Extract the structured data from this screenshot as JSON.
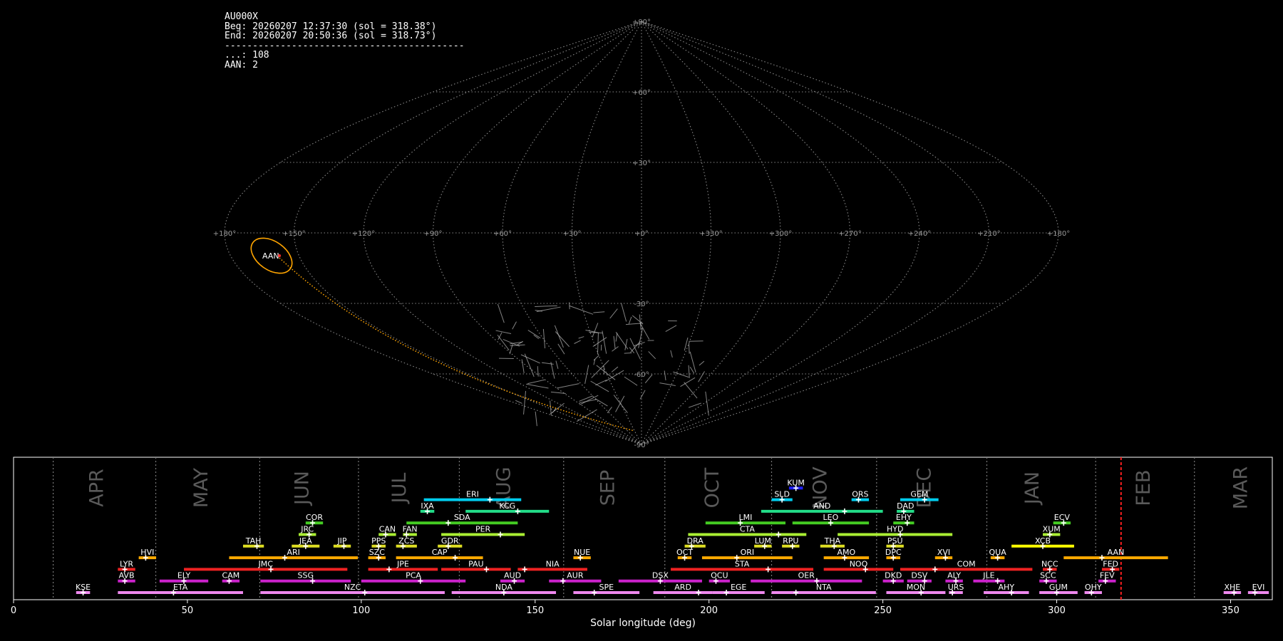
{
  "info": {
    "station": "AU000X",
    "beg": "Beg: 20260207 12:37:30 (sol = 318.38°)",
    "end": "End: 20260207 20:50:36 (sol = 318.73°)",
    "separator": "-------------------------------------------",
    "sporadic": "...: 108",
    "aan": "AAN: 2"
  },
  "sky_map": {
    "projection": "sinusoidal",
    "lon_labels": [
      "+180°",
      "+150°",
      "+120°",
      "+90°",
      "+60°",
      "+30°",
      "+0°",
      "+330°",
      "+300°",
      "+270°",
      "+240°",
      "+210°",
      "+180°"
    ],
    "lat_labels": [
      "+90°",
      "+60°",
      "+30°",
      "-30°",
      "-60°",
      "-90°"
    ],
    "radiant_label": "AAN",
    "colors": {
      "grid": "#888888",
      "radiant": "#ffa500",
      "meteor": "#bbbbbb"
    }
  },
  "chart_data": {
    "type": "gantt",
    "xlabel": "Solar longitude (deg)",
    "xlim": [
      0,
      362
    ],
    "xticks": [
      0,
      50,
      100,
      150,
      200,
      250,
      300,
      350
    ],
    "current_sol": 318.5,
    "months": [
      {
        "name": "APR",
        "start": 11.4,
        "label": 24
      },
      {
        "name": "MAY",
        "start": 40.9,
        "label": 54
      },
      {
        "name": "JUN",
        "start": 70.8,
        "label": 83
      },
      {
        "name": "JUL",
        "start": 99.2,
        "label": 111
      },
      {
        "name": "AUG",
        "start": 128.2,
        "label": 141
      },
      {
        "name": "SEP",
        "start": 158.2,
        "label": 171
      },
      {
        "name": "OCT",
        "start": 187.3,
        "label": 201
      },
      {
        "name": "NOV",
        "start": 218.0,
        "label": 232
      },
      {
        "name": "DEC",
        "start": 248.2,
        "label": 262
      },
      {
        "name": "JAN",
        "start": 279.9,
        "label": 293
      },
      {
        "name": "FEB",
        "start": 311.2,
        "label": 325
      },
      {
        "name": "MAR",
        "start": 339.6,
        "label": 353
      }
    ],
    "showers": [
      {
        "code": "KUM",
        "start": 223,
        "end": 227,
        "peak": 225,
        "row": 9,
        "color": "#2020ff"
      },
      {
        "code": "ERI",
        "start": 118,
        "end": 146,
        "peak": 137,
        "row": 8,
        "color": "#00ccee"
      },
      {
        "code": "SLD",
        "start": 218,
        "end": 224,
        "peak": 221,
        "row": 8,
        "color": "#00ccee"
      },
      {
        "code": "ORS",
        "start": 241,
        "end": 246,
        "peak": 243,
        "row": 8,
        "color": "#00ccee"
      },
      {
        "code": "GEM",
        "start": 255,
        "end": 266,
        "peak": 262,
        "row": 8,
        "color": "#00ccee"
      },
      {
        "code": "IXA",
        "start": 117,
        "end": 121,
        "peak": 119,
        "row": 7,
        "color": "#22dd88"
      },
      {
        "code": "KCG",
        "start": 130,
        "end": 154,
        "peak": 145,
        "row": 7,
        "color": "#22dd88"
      },
      {
        "code": "AND",
        "start": 215,
        "end": 250,
        "peak": 239,
        "row": 7,
        "color": "#22dd88"
      },
      {
        "code": "DAD",
        "start": 254,
        "end": 259,
        "peak": 256,
        "row": 7,
        "color": "#22dd88"
      },
      {
        "code": "COR",
        "start": 84,
        "end": 89,
        "peak": 86,
        "row": 6,
        "color": "#44cc22"
      },
      {
        "code": "SDA",
        "start": 113,
        "end": 145,
        "peak": 125,
        "row": 6,
        "color": "#44cc22"
      },
      {
        "code": "LMI",
        "start": 199,
        "end": 222,
        "peak": 209,
        "row": 6,
        "color": "#44cc22"
      },
      {
        "code": "LEO",
        "start": 224,
        "end": 246,
        "peak": 235,
        "row": 6,
        "color": "#44cc22"
      },
      {
        "code": "EHY",
        "start": 253,
        "end": 259,
        "peak": 257,
        "row": 6,
        "color": "#44cc22"
      },
      {
        "code": "ECV",
        "start": 299,
        "end": 304,
        "peak": 302,
        "row": 6,
        "color": "#44cc22"
      },
      {
        "code": "JRC",
        "start": 82,
        "end": 87,
        "peak": 85,
        "row": 5,
        "color": "#aaee33"
      },
      {
        "code": "CAN",
        "start": 105,
        "end": 110,
        "peak": 107,
        "row": 5,
        "color": "#aaee33"
      },
      {
        "code": "FAN",
        "start": 112,
        "end": 116,
        "peak": 113,
        "row": 5,
        "color": "#aaee33"
      },
      {
        "code": "PER",
        "start": 123,
        "end": 147,
        "peak": 140,
        "row": 5,
        "color": "#aaee33"
      },
      {
        "code": "CTA",
        "start": 194,
        "end": 228,
        "peak": 220,
        "row": 5,
        "color": "#aaee33"
      },
      {
        "code": "HYD",
        "start": 237,
        "end": 270,
        "peak": 255,
        "row": 5,
        "color": "#aaee33"
      },
      {
        "code": "XUM",
        "start": 296,
        "end": 301,
        "peak": 298,
        "row": 5,
        "color": "#aaee33"
      },
      {
        "code": "TAH",
        "start": 66,
        "end": 72,
        "peak": 70,
        "row": 4,
        "color": "#dddd22"
      },
      {
        "code": "JEA",
        "start": 80,
        "end": 88,
        "peak": 84,
        "row": 4,
        "color": "#dddd22"
      },
      {
        "code": "JIP",
        "start": 92,
        "end": 97,
        "peak": 95,
        "row": 4,
        "color": "#dddd22"
      },
      {
        "code": "PPS",
        "start": 103,
        "end": 107,
        "peak": 105,
        "row": 4,
        "color": "#dddd22"
      },
      {
        "code": "ZCS",
        "start": 110,
        "end": 116,
        "peak": 112,
        "row": 4,
        "color": "#dddd22"
      },
      {
        "code": "GDR",
        "start": 122,
        "end": 129,
        "peak": 125,
        "row": 4,
        "color": "#dddd22"
      },
      {
        "code": "DRA",
        "start": 193,
        "end": 199,
        "peak": 195,
        "row": 4,
        "color": "#dddd22"
      },
      {
        "code": "LUM",
        "start": 213,
        "end": 218,
        "peak": 216,
        "row": 4,
        "color": "#dddd22"
      },
      {
        "code": "RPU",
        "start": 221,
        "end": 226,
        "peak": 224,
        "row": 4,
        "color": "#dddd22"
      },
      {
        "code": "THA",
        "start": 232,
        "end": 239,
        "peak": 236,
        "row": 4,
        "color": "#dddd22"
      },
      {
        "code": "PSU",
        "start": 251,
        "end": 256,
        "peak": 253,
        "row": 4,
        "color": "#dddd22"
      },
      {
        "code": "XCB",
        "start": 287,
        "end": 305,
        "peak": 296,
        "row": 4,
        "color": "#ffff00"
      },
      {
        "code": "HVI",
        "start": 36,
        "end": 41,
        "peak": 38,
        "row": 3,
        "color": "#ffaa00"
      },
      {
        "code": "ARI",
        "start": 62,
        "end": 99,
        "peak": 78,
        "row": 3,
        "color": "#ffaa00"
      },
      {
        "code": "SZC",
        "start": 102,
        "end": 107,
        "peak": 105,
        "row": 3,
        "color": "#ffaa00"
      },
      {
        "code": "CAP",
        "start": 110,
        "end": 135,
        "peak": 127,
        "row": 3,
        "color": "#ffaa00"
      },
      {
        "code": "NUE",
        "start": 161,
        "end": 166,
        "peak": 163,
        "row": 3,
        "color": "#ffaa00"
      },
      {
        "code": "OCT",
        "start": 191,
        "end": 195,
        "peak": 193,
        "row": 3,
        "color": "#ffaa00"
      },
      {
        "code": "ORI",
        "start": 198,
        "end": 224,
        "peak": 208,
        "row": 3,
        "color": "#ffaa00"
      },
      {
        "code": "AMO",
        "start": 233,
        "end": 246,
        "peak": 239,
        "row": 3,
        "color": "#ffaa00"
      },
      {
        "code": "DPC",
        "start": 251,
        "end": 255,
        "peak": 253,
        "row": 3,
        "color": "#ffaa00"
      },
      {
        "code": "XVI",
        "start": 265,
        "end": 270,
        "peak": 268,
        "row": 3,
        "color": "#ffaa00"
      },
      {
        "code": "QUA",
        "start": 281,
        "end": 285,
        "peak": 283,
        "row": 3,
        "color": "#ffaa00"
      },
      {
        "code": "AAN",
        "start": 302,
        "end": 332,
        "peak": 313,
        "row": 3,
        "color": "#ffaa00"
      },
      {
        "code": "LYR",
        "start": 30,
        "end": 35,
        "peak": 32,
        "row": 2,
        "color": "#ee2222"
      },
      {
        "code": "JMC",
        "start": 49,
        "end": 96,
        "peak": 74,
        "row": 2,
        "color": "#ee2222"
      },
      {
        "code": "JPE",
        "start": 102,
        "end": 122,
        "peak": 108,
        "row": 2,
        "color": "#ee2222"
      },
      {
        "code": "PAU",
        "start": 123,
        "end": 143,
        "peak": 136,
        "row": 2,
        "color": "#ee2222"
      },
      {
        "code": "NIA",
        "start": 145,
        "end": 165,
        "peak": 147,
        "row": 2,
        "color": "#ee2222"
      },
      {
        "code": "STA",
        "start": 189,
        "end": 230,
        "peak": 217,
        "row": 2,
        "color": "#ee2222"
      },
      {
        "code": "NOO",
        "start": 233,
        "end": 253,
        "peak": 245,
        "row": 2,
        "color": "#ee2222"
      },
      {
        "code": "COM",
        "start": 255,
        "end": 293,
        "peak": 265,
        "row": 2,
        "color": "#ee2222"
      },
      {
        "code": "NCC",
        "start": 296,
        "end": 300,
        "peak": 298,
        "row": 2,
        "color": "#ee2222"
      },
      {
        "code": "FED",
        "start": 313,
        "end": 318,
        "peak": 316,
        "row": 2,
        "color": "#ee2222"
      },
      {
        "code": "AVB",
        "start": 30,
        "end": 35,
        "peak": 32,
        "row": 1,
        "color": "#cc22cc"
      },
      {
        "code": "ELY",
        "start": 42,
        "end": 56,
        "peak": 49,
        "row": 1,
        "color": "#cc22cc"
      },
      {
        "code": "CAM",
        "start": 60,
        "end": 65,
        "peak": 62,
        "row": 1,
        "color": "#cc22cc"
      },
      {
        "code": "SSG",
        "start": 71,
        "end": 97,
        "peak": 86,
        "row": 1,
        "color": "#cc22cc"
      },
      {
        "code": "PCA",
        "start": 100,
        "end": 130,
        "peak": 117,
        "row": 1,
        "color": "#cc22cc"
      },
      {
        "code": "AUD",
        "start": 140,
        "end": 147,
        "peak": 144,
        "row": 1,
        "color": "#cc22cc"
      },
      {
        "code": "AUR",
        "start": 154,
        "end": 169,
        "peak": 158,
        "row": 1,
        "color": "#cc22cc"
      },
      {
        "code": "DSX",
        "start": 174,
        "end": 198,
        "peak": 186,
        "row": 1,
        "color": "#cc22cc"
      },
      {
        "code": "OCU",
        "start": 200,
        "end": 206,
        "peak": 202,
        "row": 1,
        "color": "#cc22cc"
      },
      {
        "code": "OER",
        "start": 212,
        "end": 244,
        "peak": 231,
        "row": 1,
        "color": "#cc22cc"
      },
      {
        "code": "DKD",
        "start": 250,
        "end": 256,
        "peak": 253,
        "row": 1,
        "color": "#cc22cc"
      },
      {
        "code": "DSV",
        "start": 257,
        "end": 264,
        "peak": 262,
        "row": 1,
        "color": "#cc22cc"
      },
      {
        "code": "ALY",
        "start": 268,
        "end": 273,
        "peak": 271,
        "row": 1,
        "color": "#cc22cc"
      },
      {
        "code": "JLE",
        "start": 276,
        "end": 285,
        "peak": 283,
        "row": 1,
        "color": "#cc22cc"
      },
      {
        "code": "SCC",
        "start": 295,
        "end": 300,
        "peak": 297,
        "row": 1,
        "color": "#cc22cc"
      },
      {
        "code": "FEV",
        "start": 312,
        "end": 317,
        "peak": 314,
        "row": 1,
        "color": "#cc22cc"
      },
      {
        "code": "KSE",
        "start": 18,
        "end": 22,
        "peak": 20,
        "row": 0,
        "color": "#ee88ee"
      },
      {
        "code": "ETA",
        "start": 30,
        "end": 66,
        "peak": 46,
        "row": 0,
        "color": "#ee88ee"
      },
      {
        "code": "NZC",
        "start": 71,
        "end": 124,
        "peak": 101,
        "row": 0,
        "color": "#ee88ee"
      },
      {
        "code": "NDA",
        "start": 126,
        "end": 156,
        "peak": 141,
        "row": 0,
        "color": "#ee88ee"
      },
      {
        "code": "SPE",
        "start": 161,
        "end": 180,
        "peak": 167,
        "row": 0,
        "color": "#ee88ee"
      },
      {
        "code": "ARD",
        "start": 184,
        "end": 201,
        "peak": 197,
        "row": 0,
        "color": "#ee88ee"
      },
      {
        "code": "EGE",
        "start": 201,
        "end": 216,
        "peak": 205,
        "row": 0,
        "color": "#ee88ee"
      },
      {
        "code": "NTA",
        "start": 218,
        "end": 248,
        "peak": 225,
        "row": 0,
        "color": "#ee88ee"
      },
      {
        "code": "MON",
        "start": 251,
        "end": 268,
        "peak": 261,
        "row": 0,
        "color": "#ee88ee"
      },
      {
        "code": "URS",
        "start": 269,
        "end": 273,
        "peak": 270,
        "row": 0,
        "color": "#ee88ee"
      },
      {
        "code": "AHY",
        "start": 279,
        "end": 292,
        "peak": 287,
        "row": 0,
        "color": "#ee88ee"
      },
      {
        "code": "GUM",
        "start": 295,
        "end": 306,
        "peak": 300,
        "row": 0,
        "color": "#ee88ee"
      },
      {
        "code": "OHY",
        "start": 308,
        "end": 313,
        "peak": 310,
        "row": 0,
        "color": "#ee88ee"
      },
      {
        "code": "XHE",
        "start": 348,
        "end": 353,
        "peak": 351,
        "row": 0,
        "color": "#ee88ee"
      },
      {
        "code": "EVI",
        "start": 355,
        "end": 361,
        "peak": 357,
        "row": 0,
        "color": "#ee88ee"
      }
    ]
  }
}
